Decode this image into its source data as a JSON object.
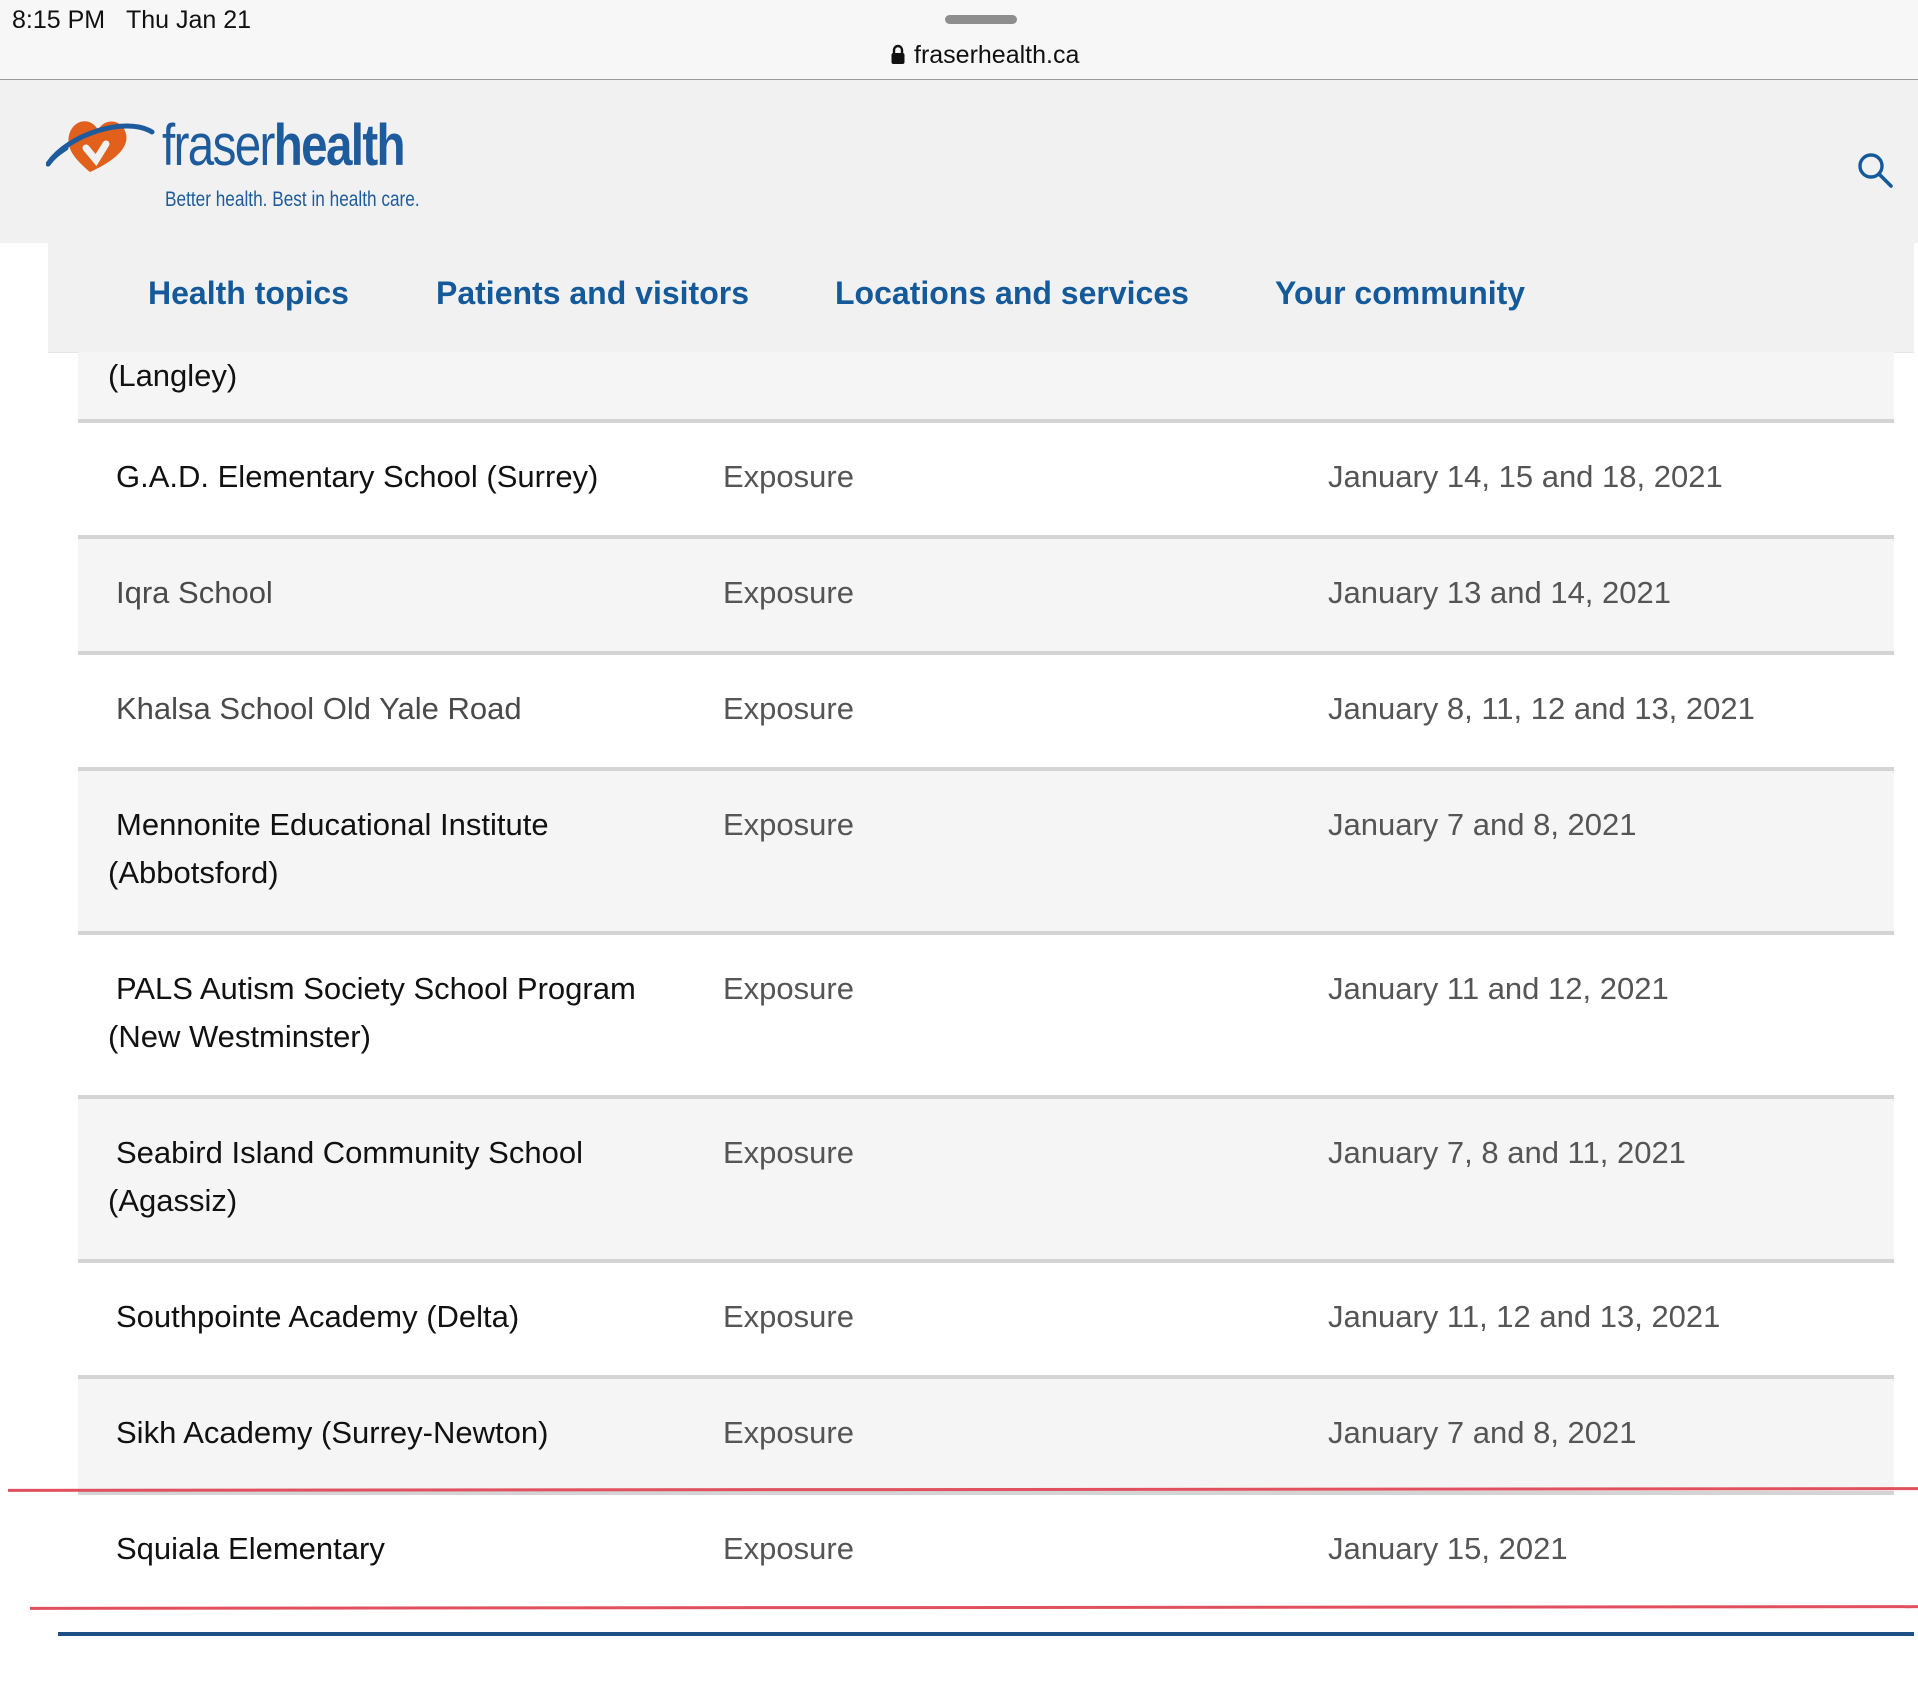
{
  "status_bar": {
    "time": "8:15 PM",
    "date": "Thu Jan 21",
    "url": "fraserhealth.ca"
  },
  "logo": {
    "wordmark_light": "fraser",
    "wordmark_bold": "health",
    "tagline": "Better health. Best in health care."
  },
  "nav": {
    "items": [
      "Health topics",
      "Patients and visitors",
      "Locations and services",
      "Your community"
    ]
  },
  "table": {
    "partial_row_text": "(Langley)",
    "rows": [
      {
        "name": "G.A.D. Elementary School (Surrey)",
        "type": "Exposure",
        "dates": "January 14, 15 and 18, 2021"
      },
      {
        "name": "Iqra School",
        "type": "Exposure",
        "dates": "January 13 and 14, 2021"
      },
      {
        "name": "Khalsa School Old Yale Road",
        "type": "Exposure",
        "dates": "January 8, 11, 12 and 13, 2021"
      },
      {
        "name": "Mennonite Educational Institute (Abbotsford)",
        "type": "Exposure",
        "dates": "January 7 and 8, 2021"
      },
      {
        "name": "PALS Autism Society School Program (New Westminster)",
        "type": "Exposure",
        "dates": "January 11 and 12, 2021"
      },
      {
        "name": "Seabird Island Community School (Agassiz)",
        "type": "Exposure",
        "dates": "January 7, 8 and 11, 2021"
      },
      {
        "name": "Southpointe Academy (Delta)",
        "type": "Exposure",
        "dates": "January 11, 12 and 13, 2021"
      },
      {
        "name": "Sikh Academy (Surrey-Newton)",
        "type": "Exposure",
        "dates": "January 7 and 8, 2021"
      },
      {
        "name": "Squiala Elementary",
        "type": "Exposure",
        "dates": "January 15, 2021"
      }
    ]
  },
  "colors": {
    "brand_blue": "#145a9a",
    "logo_orange": "#e0601c",
    "highlight_red": "#e0505e"
  }
}
